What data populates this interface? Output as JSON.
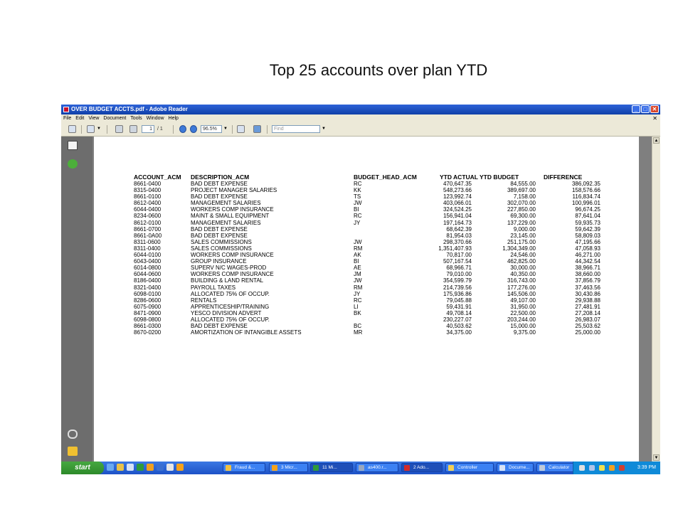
{
  "slide": {
    "title": "Top 25 accounts over plan YTD"
  },
  "window": {
    "title": "OVER BUDGET ACCTS.pdf - Adobe Reader",
    "buttons": {
      "minimize": "_",
      "maximize": "□",
      "close": "✕"
    },
    "doc_close": "✕"
  },
  "menu": {
    "items": [
      "File",
      "Edit",
      "View",
      "Document",
      "Tools",
      "Window",
      "Help"
    ]
  },
  "toolbar": {
    "page_current": "1",
    "page_total": "/ 1",
    "zoom": "96.5%",
    "find_placeholder": "Find"
  },
  "report": {
    "headers": [
      "ACCOUNT_ACM",
      "DESCRIPTION_ACM",
      "BUDGET_HEAD_ACM",
      "YTD ACTUAL",
      "YTD BUDGET",
      "DIFFERENCE"
    ],
    "rows": [
      [
        "8661-0400",
        "BAD DEBT EXPENSE",
        "RC",
        "470,647.35",
        "84,555.00",
        "386,092.35"
      ],
      [
        "8315-0400",
        "PROJECT MANAGER SALARIES",
        "KK",
        "548,273.66",
        "389,697.00",
        "158,576.66"
      ],
      [
        "8661-0100",
        "BAD DEBT EXPENSE",
        "TS",
        "123,992.74",
        "7,158.00",
        "116,834.74"
      ],
      [
        "8612-0400",
        "MANAGEMENT SALARIES",
        "JW",
        "403,066.01",
        "302,070.00",
        "100,996.01"
      ],
      [
        "6044-0400",
        "WORKERS COMP INSURANCE",
        "BI",
        "324,524.25",
        "227,850.00",
        "96,674.25"
      ],
      [
        "8234-0600",
        "MAINT & SMALL EQUIPMENT",
        "RC",
        "156,941.04",
        "69,300.00",
        "87,641.04"
      ],
      [
        "8612-0100",
        "MANAGEMENT SALARIES",
        "JY",
        "197,164.73",
        "137,229.00",
        "59,935.73"
      ],
      [
        "8661-0700",
        "BAD DEBT EXPENSE",
        "",
        "68,642.39",
        "9,000.00",
        "59,642.39"
      ],
      [
        "8661-0A00",
        "BAD DEBT EXPENSE",
        "",
        "81,954.03",
        "23,145.00",
        "58,809.03"
      ],
      [
        "8311-0600",
        "SALES COMMISSIONS",
        "JW",
        "298,370.66",
        "251,175.00",
        "47,195.66"
      ],
      [
        "8311-0400",
        "SALES COMMISSIONS",
        "RM",
        "1,351,407.93",
        "1,304,349.00",
        "47,058.93"
      ],
      [
        "6044-0100",
        "WORKERS COMP INSURANCE",
        "AK",
        "70,817.00",
        "24,546.00",
        "46,271.00"
      ],
      [
        "6043-0400",
        "GROUP INSURANCE",
        "BI",
        "507,167.54",
        "462,825.00",
        "44,342.54"
      ],
      [
        "6014-0800",
        "SUPERV N/C WAGES-PROD",
        "AE",
        "68,966.71",
        "30,000.00",
        "38,966.71"
      ],
      [
        "6044-0600",
        "WORKERS COMP INSURANCE",
        "JM",
        "79,010.00",
        "40,350.00",
        "38,660.00"
      ],
      [
        "8186-0400",
        "BUILDING & LAND RENTAL",
        "JW",
        "354,599.79",
        "316,743.00",
        "37,856.79"
      ],
      [
        "8321-0400",
        "PAYROLL TAXES",
        "RM",
        "214,739.56",
        "177,276.00",
        "37,463.56"
      ],
      [
        "6098-0100",
        "ALLOCATED 75% OF OCCUP.",
        "JY",
        "175,936.86",
        "145,506.00",
        "30,430.86"
      ],
      [
        "8286-0600",
        "RENTALS",
        "RC",
        "79,045.88",
        "49,107.00",
        "29,938.88"
      ],
      [
        "6075-0900",
        "APPRENTICESHIP/TRAINING",
        "LI",
        "59,431.91",
        "31,950.00",
        "27,481.91"
      ],
      [
        "8471-0900",
        "YESCO DIVISION ADVERT",
        "BK",
        "49,708.14",
        "22,500.00",
        "27,208.14"
      ],
      [
        "6098-0800",
        "ALLOCATED 75% OF OCCUP.",
        "",
        "230,227.07",
        "203,244.00",
        "26,983.07"
      ],
      [
        "8661-0300",
        "BAD DEBT EXPENSE",
        "BC",
        "40,503.62",
        "15,000.00",
        "25,503.62"
      ],
      [
        "8670-0200",
        "AMORTIZATION OF INTANGIBLE ASSETS",
        "MR",
        "34,375.00",
        "9,375.00",
        "25,000.00"
      ]
    ]
  },
  "taskbar": {
    "start_label": "start",
    "tasks": [
      {
        "label": "Fraud &...",
        "color": "#f0c040"
      },
      {
        "label": "3 Micr...",
        "color": "#f6a21a"
      },
      {
        "label": "11 Mi...",
        "color": "#2e9a3a"
      },
      {
        "label": "as400.r...",
        "color": "#9aa8c0"
      },
      {
        "label": "2 Ado...",
        "color": "#d22a2a"
      },
      {
        "label": "Controller",
        "color": "#f2cf55"
      },
      {
        "label": "Docume...",
        "color": "#d8e2f5"
      },
      {
        "label": "Calculator",
        "color": "#bfc9d9"
      }
    ],
    "clock": "3:39 PM"
  }
}
